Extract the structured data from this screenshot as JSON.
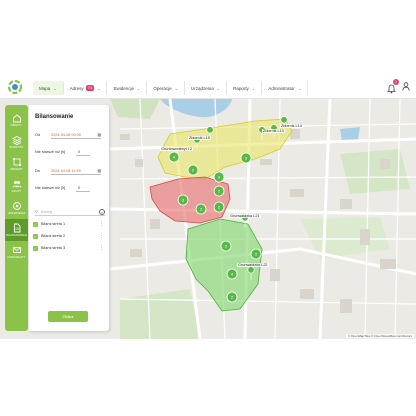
{
  "nav": {
    "items": [
      {
        "label": "Mapa",
        "active": true,
        "chevron": true
      },
      {
        "label": "Adresy",
        "badge": "74",
        "chevron": true
      },
      {
        "label": "Ewidencje",
        "chevron": true
      },
      {
        "label": "Operacje",
        "chevron": true
      },
      {
        "label": "Urządzenia",
        "chevron": true
      },
      {
        "label": "Raporty",
        "chevron": true
      },
      {
        "label": "Administrator",
        "chevron": true
      }
    ],
    "bell_badge": "1"
  },
  "sidebar": {
    "items": [
      {
        "label": "Obiekty",
        "icon": "home-icon"
      },
      {
        "label": "Warstwy",
        "icon": "layers-icon"
      },
      {
        "label": "Obszary",
        "icon": "area-icon"
      },
      {
        "label": "Grupy",
        "icon": "group-icon"
      },
      {
        "label": "Urządzenia",
        "icon": "device-icon"
      },
      {
        "label": "Bilansowanie",
        "icon": "file-icon",
        "active": true
      },
      {
        "label": "Komunikaty",
        "icon": "mail-icon"
      }
    ]
  },
  "panel": {
    "title": "Bilansowanie",
    "from_label": "Od",
    "from_value": "2024-04-08 00:00",
    "to_label": "Do",
    "to_value": "2024-04-08 11:59",
    "older_label": "Nie starsze niż [h]",
    "older_from": "0",
    "older_to": "0",
    "search_placeholder": "Szukaj",
    "list": [
      "Bilans strefa 1",
      "Bilans strefa 2",
      "Bilans strefa 3"
    ],
    "button": "Oblicz"
  },
  "map": {
    "labels": [
      "Zbiornik L14",
      "Zbiornik L13",
      "Zbiornik L15",
      "Gruntowodebyt L2",
      "Grunwaldzka L21",
      "Grunwaldzka L22"
    ],
    "attribution": "© OpenMapTiles © OpenStreetMap contributors",
    "zones": [
      {
        "color": "#e8e35a",
        "markers": [
          "4",
          "3",
          "2",
          "3",
          "2"
        ]
      },
      {
        "color": "#e86b6b",
        "markers": [
          "3",
          "3",
          "2"
        ]
      },
      {
        "color": "#7fd66a",
        "markers": [
          "2",
          "2",
          "4",
          "2"
        ]
      }
    ]
  }
}
